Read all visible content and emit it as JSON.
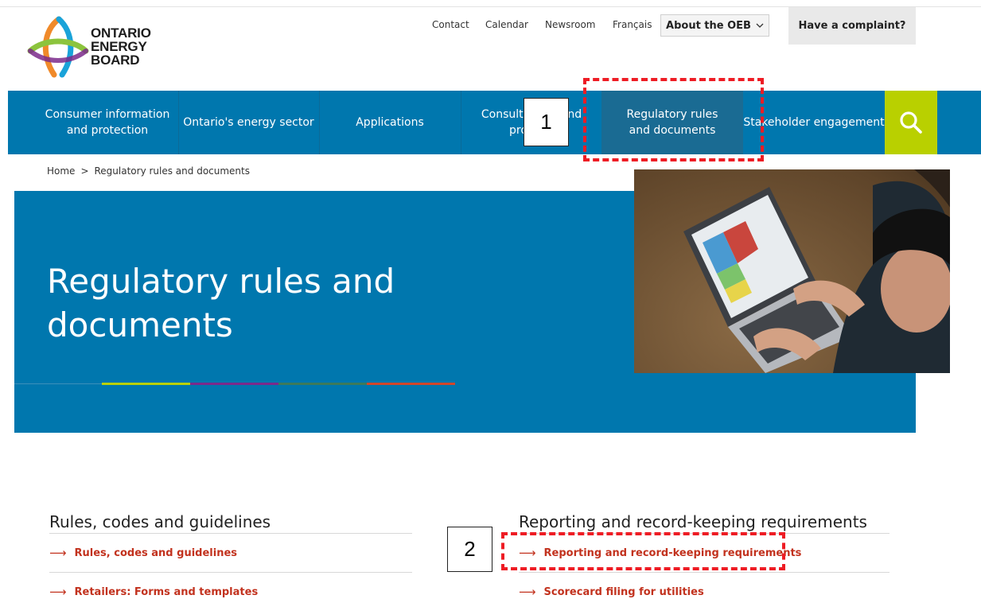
{
  "brand": {
    "logo_lines": [
      "ONTARIO",
      "ENERGY",
      "BOARD"
    ]
  },
  "utility_nav": {
    "contact": "Contact",
    "calendar": "Calendar",
    "newsroom": "Newsroom",
    "francais": "Français",
    "about": "About the OEB",
    "complaint": "Have a complaint?"
  },
  "main_nav": {
    "items": [
      "Consumer information and protection",
      "Ontario's energy sector",
      "Applications",
      "Consultations and projects",
      "Regulatory rules and documents",
      "Stakeholder engagement"
    ],
    "active_index": 4
  },
  "annotations": {
    "one": "1",
    "two": "2"
  },
  "breadcrumb": {
    "home": "Home",
    "separator": ">",
    "current": "Regulatory rules and documents"
  },
  "hero": {
    "title": "Regulatory rules and documents",
    "bar_colors": [
      "#b9d000",
      "#7b2a8b",
      "#3d7a5a",
      "#d2462a"
    ]
  },
  "sections": {
    "left": {
      "title": "Rules, codes and guidelines",
      "links": [
        "Rules, codes and guidelines",
        "Retailers: Forms and templates"
      ]
    },
    "right": {
      "title": "Reporting and record-keeping requirements",
      "links": [
        "Reporting and record-keeping requirements",
        "Scorecard filing for utilities"
      ]
    }
  },
  "colors": {
    "accent_blue": "#0077ae",
    "search_green": "#b9d000",
    "link_red": "#c2321e",
    "annotation_red": "#ee1c24"
  }
}
